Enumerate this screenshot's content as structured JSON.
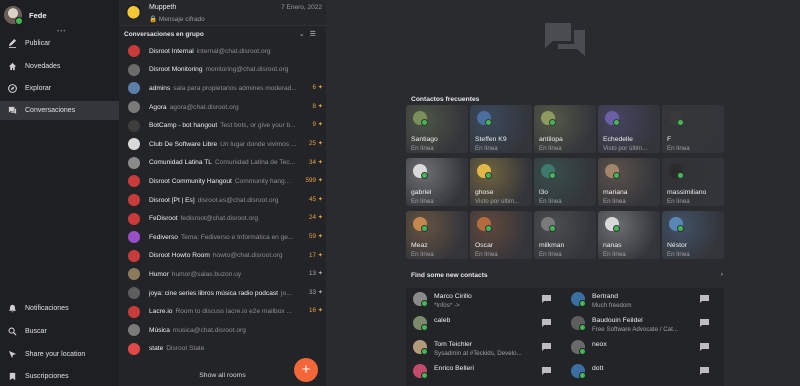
{
  "nav": {
    "profile_name": "Fede",
    "items": [
      {
        "label": "Publicar",
        "icon": "compose-icon"
      },
      {
        "label": "Novedades",
        "icon": "home-icon"
      },
      {
        "label": "Explorar",
        "icon": "compass-icon"
      },
      {
        "label": "Conversaciones",
        "icon": "chat-icon"
      }
    ],
    "bottom_items": [
      {
        "label": "Notificaciones",
        "icon": "bell-icon"
      },
      {
        "label": "Buscar",
        "icon": "search-icon"
      },
      {
        "label": "Share your location",
        "icon": "location-icon"
      },
      {
        "label": "Suscripciones",
        "icon": "bookmark-icon"
      }
    ]
  },
  "top_conversation": {
    "name": "Muppeth",
    "subtitle": "Mensaje cifrado",
    "date": "7 Enero, 2022"
  },
  "group_header": "Conversaciones en grupo",
  "rooms": [
    {
      "name": "Disroot Internal",
      "desc": "internal@chat.disroot.org",
      "count": "",
      "color": "#c93a3a",
      "level": "none"
    },
    {
      "name": "Disroot Monitoring",
      "desc": "monitoring@chat.disroot.org",
      "count": "",
      "color": "#6b6b6b",
      "level": "none"
    },
    {
      "name": "admins",
      "desc": "sala para propietarios admines moderad...",
      "count": "6",
      "color": "#5b7fa8",
      "level": "hi"
    },
    {
      "name": "Ágora",
      "desc": "agora@chat.disroot.org",
      "count": "8",
      "color": "#7a7a7a",
      "level": "hi"
    },
    {
      "name": "BotCamp - bot hangout",
      "desc": "Test bots, or give your b...",
      "count": "9",
      "color": "#3d3d3d",
      "level": "hi"
    },
    {
      "name": "Club De Software Libre",
      "desc": "Un lugar donde vivimos ...",
      "count": "25",
      "color": "#d8d8d8",
      "level": "hi"
    },
    {
      "name": "Comunidad Latina TL",
      "desc": "Comunidad Latina de Tec...",
      "count": "34",
      "color": "#8a8a8a",
      "level": "hi"
    },
    {
      "name": "Disroot Community Hangout",
      "desc": "Community hang...",
      "count": "599",
      "color": "#c93a3a",
      "level": "hi"
    },
    {
      "name": "Disroot [Pt | Es]",
      "desc": "disroot.es@chat.disroot.org",
      "count": "45",
      "color": "#c93a3a",
      "level": "hi"
    },
    {
      "name": "FeDisroot",
      "desc": "fedisroot@chat.disroot.org",
      "count": "24",
      "color": "#c93a3a",
      "level": "hi"
    },
    {
      "name": "Fediverso",
      "desc": "Tema: Fediverso e Informática en ge...",
      "count": "59",
      "color": "#9b4ec9",
      "level": "hi"
    },
    {
      "name": "Disroot Howto Room",
      "desc": "howto@chat.disroot.org",
      "count": "17",
      "color": "#c93a3a",
      "level": "hi"
    },
    {
      "name": "Humor",
      "desc": "humor@salas.buzon.uy",
      "count": "13",
      "color": "#8c7a5e",
      "level": "lo"
    },
    {
      "name": "joya: cine series libros música radio podcast",
      "desc": "jo...",
      "count": "33",
      "color": "#5e5e5e",
      "level": "lo"
    },
    {
      "name": "Lacre.io",
      "desc": "Room to discuss lacre.io e2e mailbox ...",
      "count": "16",
      "color": "#c93a3a",
      "level": "hi"
    },
    {
      "name": "Música",
      "desc": "musica@chat.disroot.org",
      "count": "",
      "color": "#7a7a7a",
      "level": "none"
    },
    {
      "name": "state",
      "desc": "Disroot State",
      "count": "",
      "color": "#e04848",
      "level": "none"
    }
  ],
  "show_all": "Show all rooms",
  "fab_label": "+",
  "frequent_title": "Contactos frecuentes",
  "frequent": [
    {
      "name": "Santiago",
      "status": "En línea",
      "color": "#7b8f5a"
    },
    {
      "name": "Steffen K9",
      "status": "En línea",
      "color": "#4a6f9e"
    },
    {
      "name": "antilopa",
      "status": "En línea",
      "color": "#8f9a60"
    },
    {
      "name": "Echedelle",
      "status": "Visto por últim...",
      "color": "#6b5fa8"
    },
    {
      "name": "F",
      "status": "En línea",
      "color": "#3a3a3a"
    },
    {
      "name": "gabriel",
      "status": "En línea",
      "color": "#d9d9d9"
    },
    {
      "name": "ghose",
      "status": "Visto por últim...",
      "color": "#e0b84a"
    },
    {
      "name": "l3o",
      "status": "En línea",
      "color": "#3e7a6a"
    },
    {
      "name": "mariana",
      "status": "En línea",
      "color": "#a3856a"
    },
    {
      "name": "massimiliano",
      "status": "En línea",
      "color": "#2b2b2b"
    },
    {
      "name": "Meaz",
      "status": "En línea",
      "color": "#c4884f"
    },
    {
      "name": "Oscar",
      "status": "En línea",
      "color": "#b36b3f"
    },
    {
      "name": "milkman",
      "status": "En línea",
      "color": "#7a7a7a"
    },
    {
      "name": "nanas",
      "status": "En línea",
      "color": "#d8d8d8"
    },
    {
      "name": "Néstor",
      "status": "En línea",
      "color": "#5a86b5"
    }
  ],
  "find_title": "Find some new contacts",
  "new_contacts": [
    {
      "name": "Marco Cirillo",
      "sub": "*Infos* ->",
      "color": "#8a8a8a"
    },
    {
      "name": "Bertrand",
      "sub": "Much freedom",
      "color": "#3b6ea3"
    },
    {
      "name": "caleb",
      "sub": "",
      "color": "#7a8a6a"
    },
    {
      "name": "Baudouin Feildel",
      "sub": "Free Software Advocate / Cat...",
      "color": "#5e5e5e"
    },
    {
      "name": "Tom Teichler",
      "sub": "Sysadmin at #Teckids, Develo...",
      "color": "#b39a7a"
    },
    {
      "name": "neox",
      "sub": "",
      "color": "#6a6a6a"
    },
    {
      "name": "Enrico Belleri",
      "sub": "",
      "color": "#c24a6a"
    },
    {
      "name": "dott",
      "sub": "",
      "color": "#3b6ea3"
    }
  ]
}
